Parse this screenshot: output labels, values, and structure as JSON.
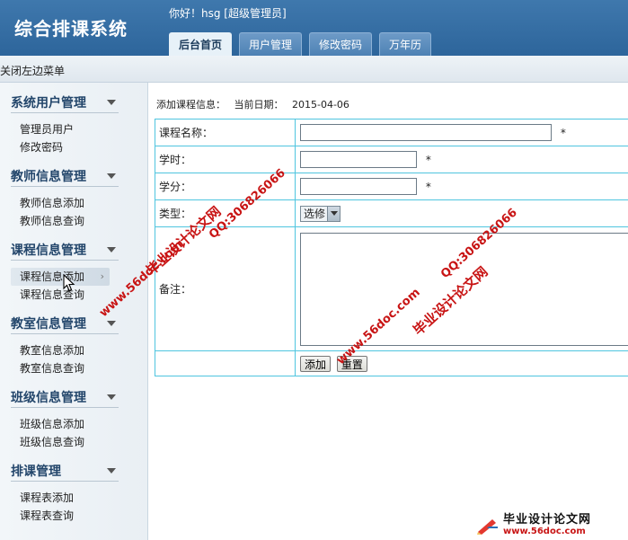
{
  "app": {
    "title": "综合排课系统",
    "greeting": "你好！hsg [超级管理员]"
  },
  "tabs": [
    {
      "label": "后台首页",
      "active": true
    },
    {
      "label": "用户管理",
      "active": false
    },
    {
      "label": "修改密码",
      "active": false
    },
    {
      "label": "万年历",
      "active": false
    }
  ],
  "toolbar": {
    "close_menu": "关闭左边菜单"
  },
  "sidebar": {
    "groups": [
      {
        "title": "系统用户管理",
        "items": [
          "管理员用户",
          "修改密码"
        ]
      },
      {
        "title": "教师信息管理",
        "items": [
          "教师信息添加",
          "教师信息查询"
        ]
      },
      {
        "title": "课程信息管理",
        "items": [
          "课程信息添加",
          "课程信息查询"
        ]
      },
      {
        "title": "教室信息管理",
        "items": [
          "教室信息添加",
          "教室信息查询"
        ]
      },
      {
        "title": "班级信息管理",
        "items": [
          "班级信息添加",
          "班级信息查询"
        ]
      },
      {
        "title": "排课管理",
        "items": [
          "课程表添加",
          "课程表查询"
        ]
      }
    ],
    "hovered_item": "课程信息添加"
  },
  "main": {
    "crumb_label": "添加课程信息：",
    "date_label": "当前日期：",
    "date_value": "2015-04-06",
    "form": {
      "name_label": "课程名称：",
      "hours_label": "学时：",
      "credit_label": "学分：",
      "type_label": "类型：",
      "type_value": "选修",
      "remark_label": "备注：",
      "required_mark": "*",
      "add_button": "添加",
      "reset_button": "重置"
    }
  },
  "watermarks": {
    "site": "www.56doc.com",
    "qq": "QQ:306826066",
    "brand": "毕业设计论文网",
    "footer_brand": "毕业设计论文网",
    "footer_url": "www.56doc.com"
  },
  "colors": {
    "header_blue": "#2d659b",
    "table_border": "#4fc5df",
    "watermark_red": "#c81414"
  }
}
